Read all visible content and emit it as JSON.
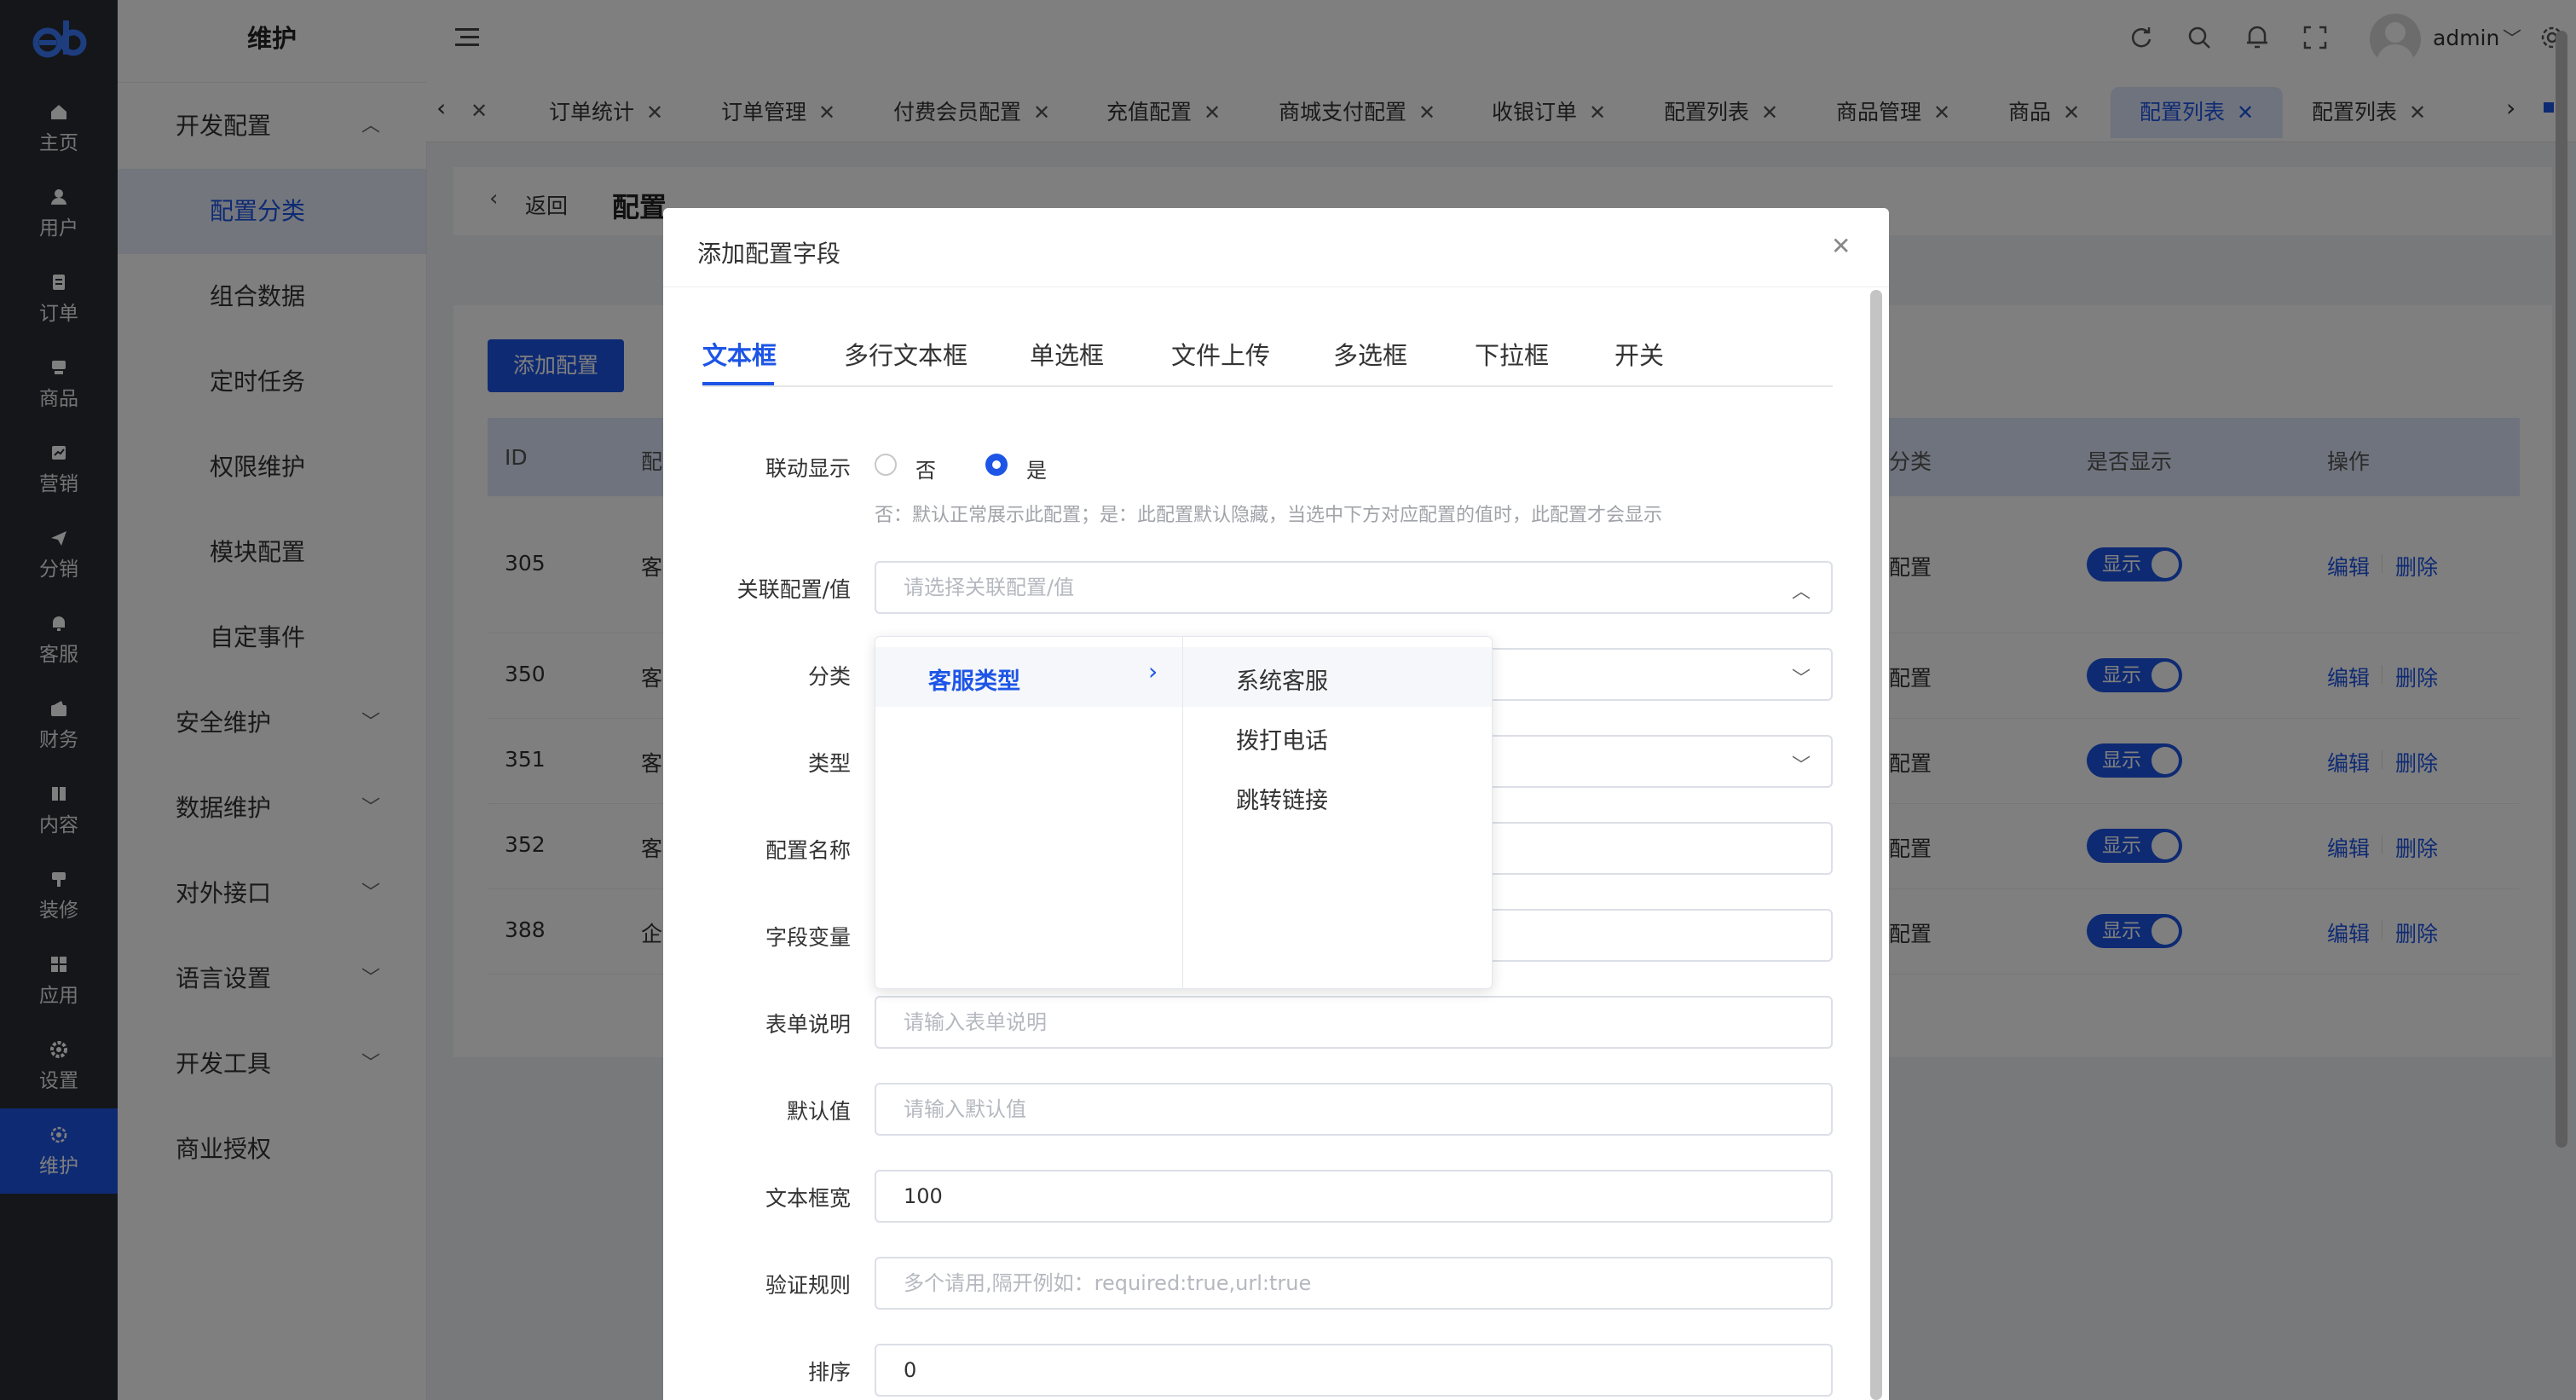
{
  "rail": {
    "logo": "eb",
    "items": [
      {
        "label": "主页",
        "icon": "home-icon"
      },
      {
        "label": "用户",
        "icon": "user-icon"
      },
      {
        "label": "订单",
        "icon": "order-icon"
      },
      {
        "label": "商品",
        "icon": "product-icon"
      },
      {
        "label": "营销",
        "icon": "chart-icon"
      },
      {
        "label": "分销",
        "icon": "send-icon"
      },
      {
        "label": "客服",
        "icon": "bell-icon"
      },
      {
        "label": "财务",
        "icon": "wallet-icon"
      },
      {
        "label": "内容",
        "icon": "book-icon"
      },
      {
        "label": "装修",
        "icon": "brush-icon"
      },
      {
        "label": "应用",
        "icon": "grid-icon"
      },
      {
        "label": "设置",
        "icon": "gear-icon"
      },
      {
        "label": "维护",
        "icon": "maintenance-icon"
      }
    ]
  },
  "submenu": {
    "title": "维护",
    "items": [
      "开发配置",
      "配置分类",
      "组合数据",
      "定时任务",
      "权限维护",
      "模块配置",
      "自定事件",
      "安全维护",
      "数据维护",
      "对外接口",
      "语言设置",
      "开发工具",
      "商业授权"
    ]
  },
  "header": {
    "user": "admin"
  },
  "tabs": [
    "订单统计",
    "订单管理",
    "付费会员配置",
    "充值配置",
    "商城支付配置",
    "收银订单",
    "配置列表",
    "商品管理",
    "商品",
    "配置列表",
    "配置列表"
  ],
  "page": {
    "back": "返回",
    "title": "配置",
    "add_button": "添加配置",
    "columns": {
      "id": "ID",
      "name": "配",
      "category": "分类",
      "show": "是否显示",
      "ops": "操作"
    },
    "rows": [
      {
        "id": "305",
        "name": "客",
        "category": "配置",
        "switch": "显示",
        "edit": "编辑",
        "delete": "删除"
      },
      {
        "id": "350",
        "name": "客",
        "category": "配置",
        "switch": "显示",
        "edit": "编辑",
        "delete": "删除"
      },
      {
        "id": "351",
        "name": "客",
        "category": "配置",
        "switch": "显示",
        "edit": "编辑",
        "delete": "删除"
      },
      {
        "id": "352",
        "name": "客",
        "category": "配置",
        "switch": "显示",
        "edit": "编辑",
        "delete": "删除"
      },
      {
        "id": "388",
        "name": "企",
        "category": "配置",
        "switch": "显示",
        "edit": "编辑",
        "delete": "删除"
      }
    ]
  },
  "dialog": {
    "title": "添加配置字段",
    "field_tabs": [
      "文本框",
      "多行文本框",
      "单选框",
      "文件上传",
      "多选框",
      "下拉框",
      "开关"
    ],
    "linked_label": "联动显示",
    "radio_no": "否",
    "radio_yes": "是",
    "linked_hint": "否：默认正常展示此配置；是：此配置默认隐藏，当选中下方对应配置的值时，此配置才会显示",
    "assoc_label": "关联配置/值",
    "assoc_placeholder": "请选择关联配置/值",
    "category_label": "分类",
    "type_label": "类型",
    "name_label": "配置名称",
    "var_label": "字段变量",
    "desc_label": "表单说明",
    "desc_placeholder": "请输入表单说明",
    "default_label": "默认值",
    "default_placeholder": "请输入默认值",
    "width_label": "文本框宽",
    "width_value": "100",
    "rule_label": "验证规则",
    "rule_placeholder": "多个请用,隔开例如：required:true,url:true",
    "sort_label": "排序",
    "sort_value": "0",
    "cascader": {
      "level1": [
        "客服类型"
      ],
      "level2": [
        "系统客服",
        "拨打电话",
        "跳转链接"
      ]
    }
  },
  "colors": {
    "primary": "#1d55e6",
    "rail": "#282c34"
  }
}
